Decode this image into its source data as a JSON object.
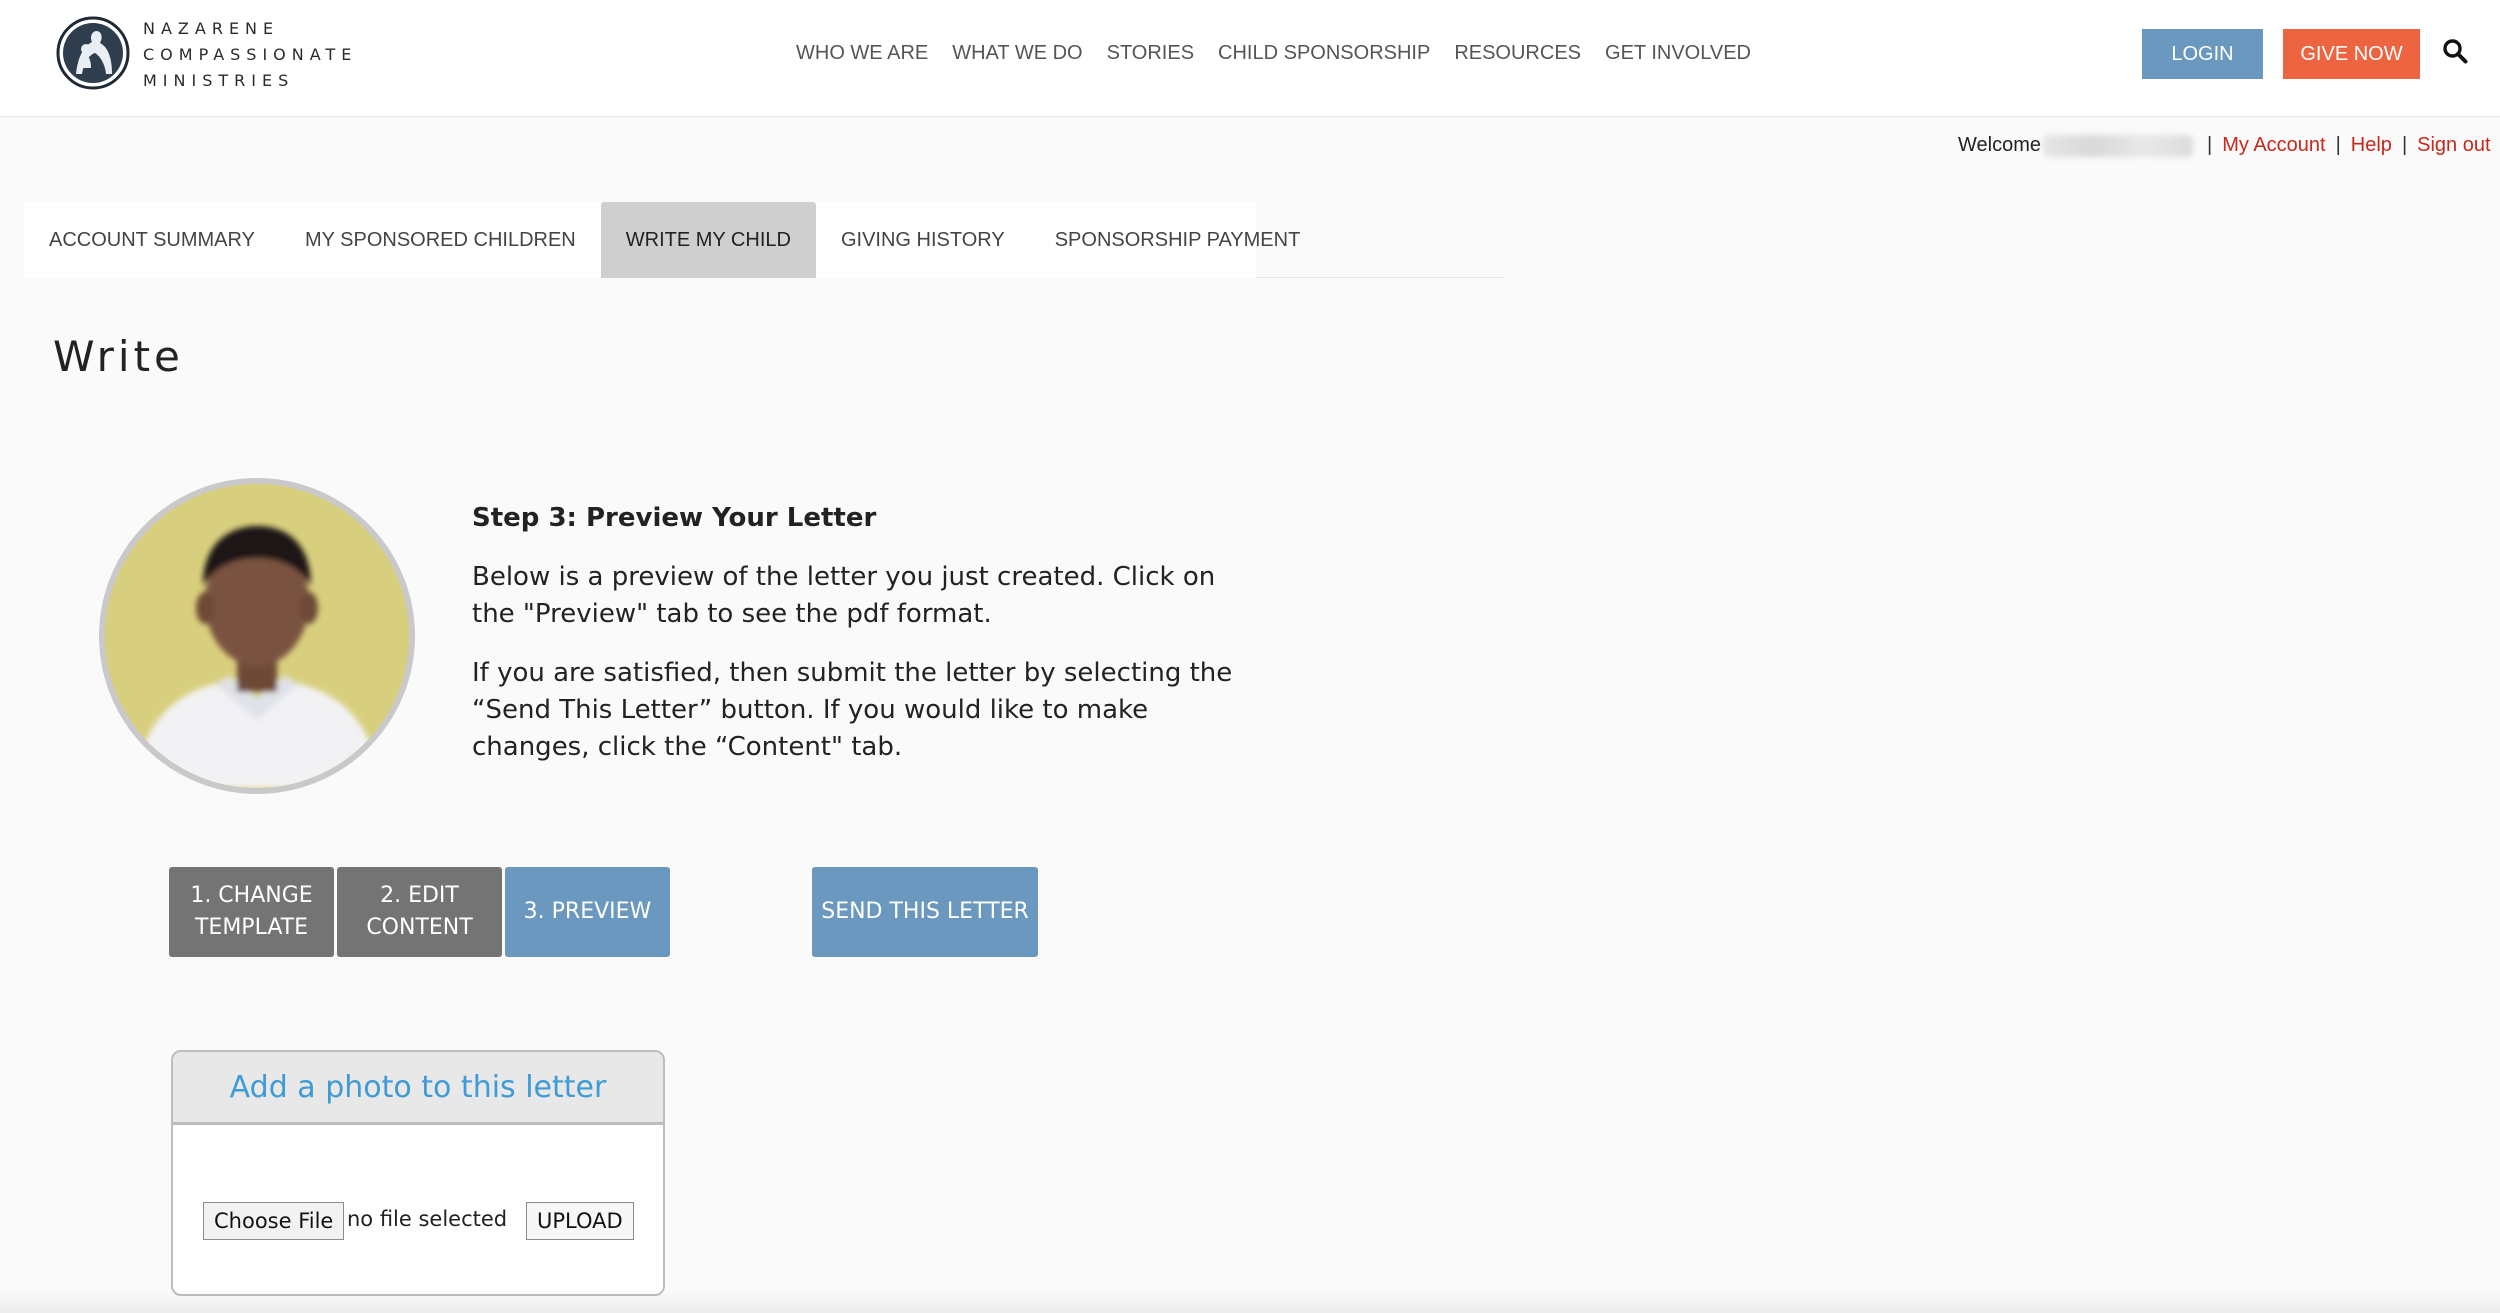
{
  "brand": {
    "logo_lines": [
      "NAZARENE",
      "COMPASSIONATE",
      "MINISTRIES"
    ]
  },
  "nav": {
    "items": [
      {
        "label": "WHO WE ARE"
      },
      {
        "label": "WHAT WE DO"
      },
      {
        "label": "STORIES"
      },
      {
        "label": "CHILD SPONSORSHIP"
      },
      {
        "label": "RESOURCES"
      },
      {
        "label": "GET INVOLVED"
      }
    ],
    "login_label": "LOGIN",
    "give_label": "GIVE NOW",
    "search_icon": "search-icon"
  },
  "account_bar": {
    "welcome_text": "Welcome",
    "links": [
      {
        "label": "My Account"
      },
      {
        "label": "Help"
      },
      {
        "label": "Sign out"
      }
    ],
    "separator": "|"
  },
  "account_tabs": [
    {
      "label": "ACCOUNT SUMMARY",
      "active": false
    },
    {
      "label": "MY SPONSORED CHILDREN",
      "active": false
    },
    {
      "label": "WRITE MY CHILD",
      "active": true
    },
    {
      "label": "GIVING HISTORY",
      "active": false
    },
    {
      "label": "SPONSORSHIP PAYMENT",
      "active": false
    }
  ],
  "page": {
    "title": "Write"
  },
  "instructions": {
    "step_title": "Step 3: Preview Your Letter",
    "paragraph_1": "Below is a preview of the letter you just created. Click on the \"Preview\" tab to see the pdf format.",
    "paragraph_2": "If you are satisfied, then submit the letter by selecting the “Send This Letter” button. If you would like to make changes, click the “Content\" tab."
  },
  "steps": {
    "change_template_line1": "1. CHANGE",
    "change_template_line2": "TEMPLATE",
    "edit_content_line1": "2. EDIT",
    "edit_content_line2": "CONTENT",
    "preview_label": "3. PREVIEW",
    "send_label": "SEND THIS LETTER"
  },
  "photo_upload": {
    "heading": "Add a photo to this letter",
    "choose_file_label": "Choose File",
    "file_status": "no file selected",
    "upload_label": "UPLOAD"
  },
  "colors": {
    "accent_blue": "#6a98be",
    "give_orange": "#ec6440",
    "link_red": "#c8281c",
    "step_gray": "#747474",
    "active_tab": "#cfcfcf",
    "photo_heading_blue": "#3e9bd6"
  }
}
